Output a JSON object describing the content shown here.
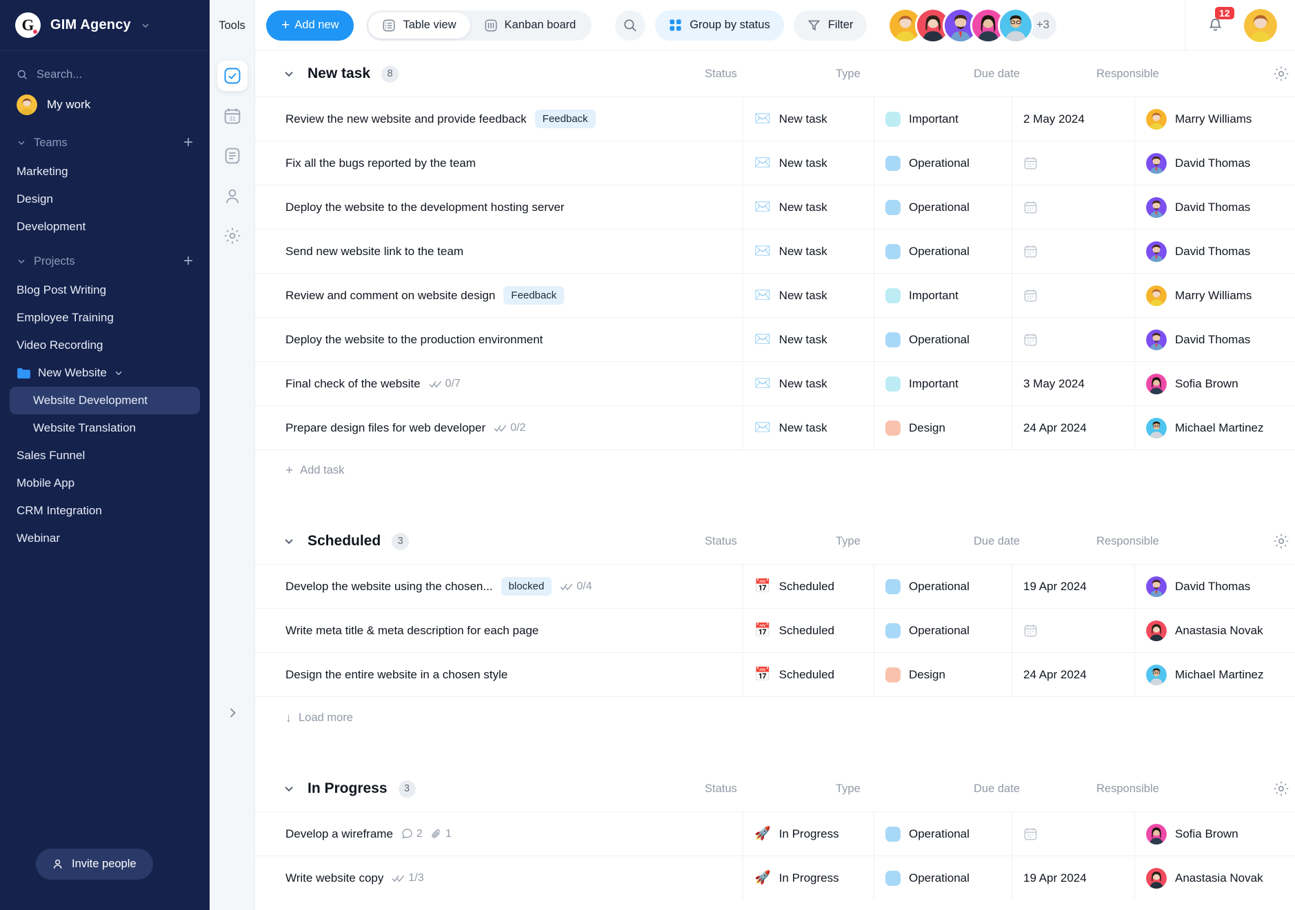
{
  "sidebar": {
    "brand": {
      "logo_letter": "G",
      "name": "GIM Agency",
      "chevron_icon": "chevron-down-icon"
    },
    "search_placeholder": "Search...",
    "my_work": "My work",
    "teams_label": "Teams",
    "teams": [
      "Marketing",
      "Design",
      "Development"
    ],
    "projects_label": "Projects",
    "projects": [
      {
        "label": "Blog Post Writing",
        "type": "item"
      },
      {
        "label": "Employee Training",
        "type": "item"
      },
      {
        "label": "Video Recording",
        "type": "item"
      },
      {
        "label": "New Website",
        "type": "folder"
      },
      {
        "label": "Website Development",
        "type": "sub",
        "active": true
      },
      {
        "label": "Website Translation",
        "type": "sub",
        "active": false
      },
      {
        "label": "Sales Funnel",
        "type": "item"
      },
      {
        "label": "Mobile App",
        "type": "item"
      },
      {
        "label": "CRM Integration",
        "type": "item"
      },
      {
        "label": "Webinar",
        "type": "item"
      }
    ],
    "invite_label": "Invite people",
    "add_icon": "plus-icon"
  },
  "rail": {
    "title": "Tools",
    "items": [
      {
        "name": "tasks-icon",
        "active": true
      },
      {
        "name": "calendar-icon",
        "active": false
      },
      {
        "name": "notes-icon",
        "active": false
      },
      {
        "name": "contacts-icon",
        "active": false
      },
      {
        "name": "settings-icon",
        "active": false
      }
    ],
    "expand_icon": "chevron-right-icon"
  },
  "topbar": {
    "add_new": "Add new",
    "views": [
      {
        "label": "Table view",
        "icon": "table-view-icon",
        "active": true
      },
      {
        "label": "Kanban board",
        "icon": "kanban-board-icon",
        "active": false
      }
    ],
    "search_icon": "search-icon",
    "group_by": "Group by status",
    "filter": "Filter",
    "more_members": "+3",
    "notifications_count": "12"
  },
  "columns": {
    "status": "Status",
    "type": "Type",
    "due_date": "Due date",
    "responsible": "Responsible",
    "settings_icon": "gear-icon"
  },
  "actions": {
    "add_task": "Add task",
    "load_more": "Load more"
  },
  "colors": {
    "accent": "#1f95f5",
    "sidebar": "#14224c",
    "type_important": "#bdecf5",
    "type_operational": "#a8d8f8",
    "type_design": "#f9c2ad",
    "tag_bg": "#e3f1fd",
    "badge_red": "#ef3b41"
  },
  "groups": [
    {
      "title": "New task",
      "count": "8",
      "footer": "add_task",
      "tasks": [
        {
          "name": "Review the new website and provide feedback",
          "tag": "Feedback",
          "status": "New task",
          "status_icon": "✉️",
          "type": "Important",
          "type_color": "#bdecf5",
          "due": "2 May 2024",
          "responsible": "Marry Williams",
          "avatar": "marry"
        },
        {
          "name": "Fix all the bugs reported by the team",
          "status": "New task",
          "status_icon": "✉️",
          "type": "Operational",
          "type_color": "#a8d8f8",
          "due": "",
          "responsible": "David Thomas",
          "avatar": "david"
        },
        {
          "name": "Deploy the website to the development hosting server",
          "status": "New task",
          "status_icon": "✉️",
          "type": "Operational",
          "type_color": "#a8d8f8",
          "due": "",
          "responsible": "David Thomas",
          "avatar": "david"
        },
        {
          "name": "Send new website link to the team",
          "status": "New task",
          "status_icon": "✉️",
          "type": "Operational",
          "type_color": "#a8d8f8",
          "due": "",
          "responsible": "David Thomas",
          "avatar": "david"
        },
        {
          "name": "Review and comment on website design",
          "tag": "Feedback",
          "status": "New task",
          "status_icon": "✉️",
          "type": "Important",
          "type_color": "#bdecf5",
          "due": "",
          "responsible": "Marry Williams",
          "avatar": "marry"
        },
        {
          "name": "Deploy the website to the production environment",
          "status": "New task",
          "status_icon": "✉️",
          "type": "Operational",
          "type_color": "#a8d8f8",
          "due": "",
          "responsible": "David Thomas",
          "avatar": "david"
        },
        {
          "name": "Final check of the website",
          "checklist": "0/7",
          "status": "New task",
          "status_icon": "✉️",
          "type": "Important",
          "type_color": "#bdecf5",
          "due": "3 May 2024",
          "responsible": "Sofia Brown",
          "avatar": "sofia"
        },
        {
          "name": "Prepare design files for web developer",
          "checklist": "0/2",
          "status": "New task",
          "status_icon": "✉️",
          "type": "Design",
          "type_color": "#f9c2ad",
          "due": "24 Apr 2024",
          "responsible": "Michael Martinez",
          "avatar": "michael"
        }
      ]
    },
    {
      "title": "Scheduled",
      "count": "3",
      "footer": "load_more",
      "tasks": [
        {
          "name": "Develop the website using the chosen...",
          "tag": "blocked",
          "checklist": "0/4",
          "status": "Scheduled",
          "status_icon": "📅",
          "type": "Operational",
          "type_color": "#a8d8f8",
          "due": "19 Apr 2024",
          "responsible": "David Thomas",
          "avatar": "david"
        },
        {
          "name": "Write meta title & meta description for each page",
          "status": "Scheduled",
          "status_icon": "📅",
          "type": "Operational",
          "type_color": "#a8d8f8",
          "due": "",
          "responsible": "Anastasia Novak",
          "avatar": "anastasia"
        },
        {
          "name": "Design the entire website in a chosen style",
          "status": "Scheduled",
          "status_icon": "📅",
          "type": "Design",
          "type_color": "#f9c2ad",
          "due": "24 Apr 2024",
          "responsible": "Michael Martinez",
          "avatar": "michael"
        }
      ]
    },
    {
      "title": "In Progress",
      "count": "3",
      "footer": "none",
      "tasks": [
        {
          "name": "Develop a wireframe",
          "comments": "2",
          "attachments": "1",
          "status": "In Progress",
          "status_icon": "🚀",
          "type": "Operational",
          "type_color": "#a8d8f8",
          "due": "",
          "responsible": "Sofia Brown",
          "avatar": "sofia"
        },
        {
          "name": "Write website copy",
          "checklist": "1/3",
          "status": "In Progress",
          "status_icon": "🚀",
          "type": "Operational",
          "type_color": "#a8d8f8",
          "due": "19 Apr 2024",
          "responsible": "Anastasia Novak",
          "avatar": "anastasia"
        }
      ]
    }
  ]
}
